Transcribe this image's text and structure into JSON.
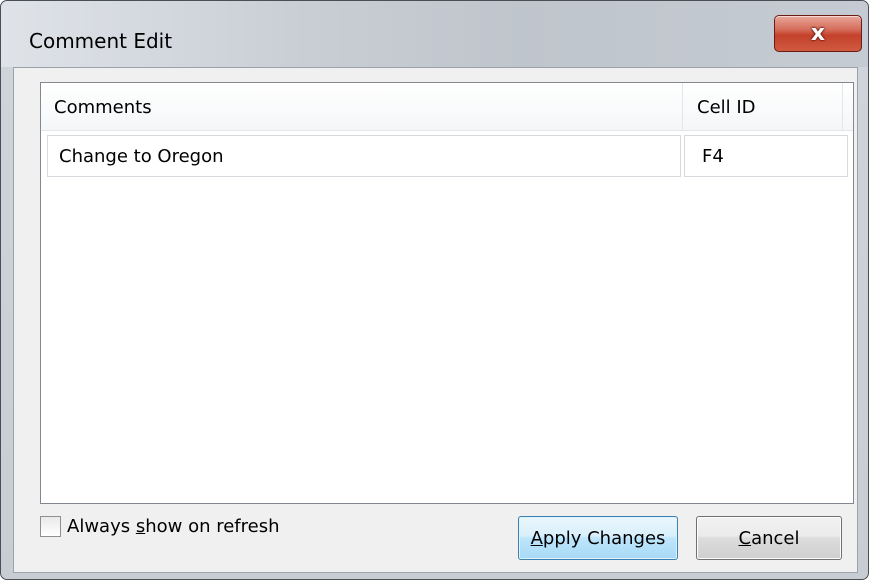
{
  "window": {
    "title": "Comment Edit",
    "close_glyph": "x"
  },
  "grid": {
    "columns": [
      "Comments",
      "Cell ID"
    ],
    "rows": [
      {
        "comment": "Change to Oregon",
        "cell_id": "F4"
      }
    ]
  },
  "options": {
    "always_show_label_pre": "Always ",
    "always_show_label_mnemonic": "s",
    "always_show_label_post": "how on refresh",
    "always_show_checked": false
  },
  "buttons": {
    "apply_mnemonic": "A",
    "apply_rest": "pply Changes",
    "cancel_mnemonic": "C",
    "cancel_rest": "ancel"
  },
  "colors": {
    "close_button": "#c4412c",
    "apply_button_border": "#3c7fb1"
  }
}
